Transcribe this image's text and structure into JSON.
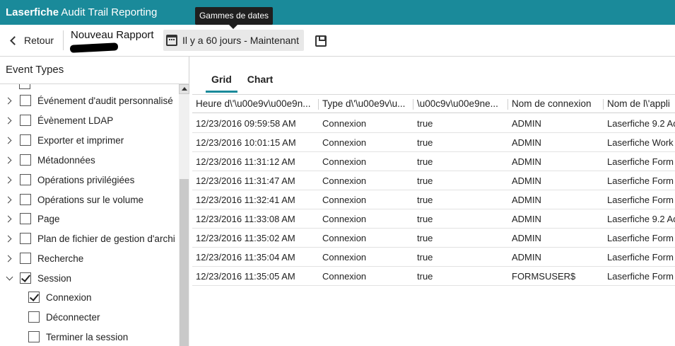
{
  "app": {
    "brand": "Laserfiche",
    "title": "Audit Trail Reporting",
    "accent": "#1a8a9a"
  },
  "tooltip": {
    "text": "Gammes de dates"
  },
  "toolbar": {
    "back_label": "Retour",
    "report_title": "Nouveau Rapport",
    "date_range": "Il y a 60 jours - Maintenant",
    "icons": {
      "back": "chevron-left-icon",
      "calendar": "calendar-icon",
      "save": "save-icon"
    }
  },
  "sidebar": {
    "title": "Event Types",
    "items": [
      {
        "label": "Événement d'audit personnalisé",
        "checked": false
      },
      {
        "label": "Évènement LDAP",
        "checked": false
      },
      {
        "label": "Exporter et imprimer",
        "checked": false
      },
      {
        "label": "Métadonnées",
        "checked": false
      },
      {
        "label": "Opérations privilégiées",
        "checked": false
      },
      {
        "label": "Opérations sur le volume",
        "checked": false
      },
      {
        "label": "Page",
        "checked": false
      },
      {
        "label": "Plan de fichier de gestion d'archi",
        "checked": false
      },
      {
        "label": "Recherche",
        "checked": false
      },
      {
        "label": "Session",
        "checked": true,
        "expanded": true
      }
    ],
    "children": [
      {
        "label": "Connexion",
        "checked": true
      },
      {
        "label": "Déconnecter",
        "checked": false
      },
      {
        "label": "Terminer la session",
        "checked": false
      }
    ]
  },
  "tabs": [
    {
      "label": "Grid",
      "active": true
    },
    {
      "label": "Chart",
      "active": false
    }
  ],
  "grid": {
    "columns": [
      "Heure d\\'\\u00e9v\\u00e9n...",
      "Type d\\'\\u00e9v\\u...",
      "\\u00c9v\\u00e9ne...",
      "Nom de connexion",
      "Nom de l\\'appli"
    ],
    "rows": [
      [
        "12/23/2016 09:59:58 AM",
        "Connexion",
        "true",
        "ADMIN",
        "Laserfiche 9.2 Ad"
      ],
      [
        "12/23/2016 10:01:15 AM",
        "Connexion",
        "true",
        "ADMIN",
        "Laserfiche Work"
      ],
      [
        "12/23/2016 11:31:12 AM",
        "Connexion",
        "true",
        "ADMIN",
        "Laserfiche Form"
      ],
      [
        "12/23/2016 11:31:47 AM",
        "Connexion",
        "true",
        "ADMIN",
        "Laserfiche Form"
      ],
      [
        "12/23/2016 11:32:41 AM",
        "Connexion",
        "true",
        "ADMIN",
        "Laserfiche Form"
      ],
      [
        "12/23/2016 11:33:08 AM",
        "Connexion",
        "true",
        "ADMIN",
        "Laserfiche 9.2 Ad"
      ],
      [
        "12/23/2016 11:35:02 AM",
        "Connexion",
        "true",
        "ADMIN",
        "Laserfiche Form"
      ],
      [
        "12/23/2016 11:35:04 AM",
        "Connexion",
        "true",
        "ADMIN",
        "Laserfiche Form"
      ],
      [
        "12/23/2016 11:35:05 AM",
        "Connexion",
        "true",
        "FORMSUSER$",
        "Laserfiche Form"
      ]
    ]
  }
}
